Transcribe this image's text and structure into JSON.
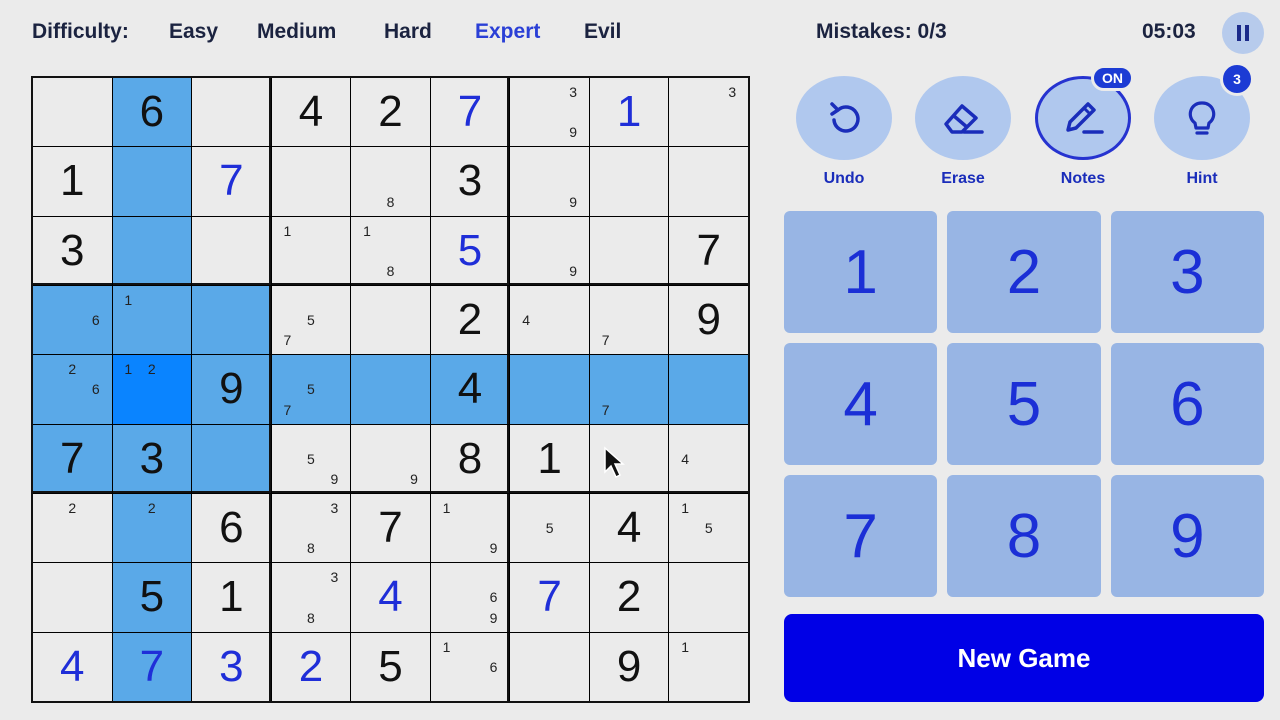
{
  "header": {
    "difficulty_label": "Difficulty:",
    "difficulties": [
      "Easy",
      "Medium",
      "Hard",
      "Expert",
      "Evil"
    ],
    "active_difficulty": "Expert",
    "mistakes": "Mistakes: 0/3",
    "timer": "05:03"
  },
  "tools": {
    "undo": "Undo",
    "erase": "Erase",
    "notes": "Notes",
    "notes_badge": "ON",
    "hint": "Hint",
    "hint_badge": "3"
  },
  "pad_numbers": [
    "1",
    "2",
    "3",
    "4",
    "5",
    "6",
    "7",
    "8",
    "9"
  ],
  "new_game": "New Game",
  "colors": {
    "accent": "#1f2ed8",
    "highlight": "#5aa9e8",
    "selected": "#0a84ff",
    "pad_key": "#98b5e4",
    "new_game": "#0000e6"
  },
  "board": {
    "selected": [
      4,
      1
    ],
    "cells": [
      [
        {
          "v": "",
          "n": []
        },
        {
          "v": "6",
          "u": false
        },
        {
          "v": "",
          "n": []
        },
        {
          "v": "4",
          "u": false
        },
        {
          "v": "2",
          "u": false
        },
        {
          "v": "7",
          "u": true
        },
        {
          "v": "",
          "n": [
            3,
            9
          ]
        },
        {
          "v": "1",
          "u": true
        },
        {
          "v": "",
          "n": [
            3
          ]
        }
      ],
      [
        {
          "v": "1",
          "u": false
        },
        {
          "v": "",
          "n": []
        },
        {
          "v": "7",
          "u": true
        },
        {
          "v": "",
          "n": []
        },
        {
          "v": "",
          "n": [
            8
          ]
        },
        {
          "v": "3",
          "u": false
        },
        {
          "v": "",
          "n": [
            9
          ]
        },
        {
          "v": "",
          "n": []
        },
        {
          "v": "",
          "n": []
        }
      ],
      [
        {
          "v": "3",
          "u": false
        },
        {
          "v": "",
          "n": []
        },
        {
          "v": "",
          "n": []
        },
        {
          "v": "",
          "n": [
            1
          ]
        },
        {
          "v": "",
          "n": [
            1,
            8
          ]
        },
        {
          "v": "5",
          "u": true
        },
        {
          "v": "",
          "n": [
            9
          ]
        },
        {
          "v": "",
          "n": []
        },
        {
          "v": "7",
          "u": false
        }
      ],
      [
        {
          "v": "",
          "n": [
            6
          ]
        },
        {
          "v": "",
          "n": [
            1
          ]
        },
        {
          "v": "",
          "n": []
        },
        {
          "v": "",
          "n": [
            5,
            7
          ]
        },
        {
          "v": "",
          "n": []
        },
        {
          "v": "2",
          "u": false
        },
        {
          "v": "",
          "n": [
            4
          ]
        },
        {
          "v": "",
          "n": [
            7
          ]
        },
        {
          "v": "9",
          "u": false
        }
      ],
      [
        {
          "v": "",
          "n": [
            2,
            6
          ]
        },
        {
          "v": "",
          "n": [
            1,
            2
          ]
        },
        {
          "v": "9",
          "u": false
        },
        {
          "v": "",
          "n": [
            5,
            7
          ]
        },
        {
          "v": "",
          "n": []
        },
        {
          "v": "4",
          "u": false
        },
        {
          "v": "",
          "n": []
        },
        {
          "v": "",
          "n": [
            7
          ]
        },
        {
          "v": "",
          "n": []
        }
      ],
      [
        {
          "v": "7",
          "u": false
        },
        {
          "v": "3",
          "u": false
        },
        {
          "v": "",
          "n": []
        },
        {
          "v": "",
          "n": [
            5,
            9
          ]
        },
        {
          "v": "",
          "n": [
            9
          ]
        },
        {
          "v": "8",
          "u": false
        },
        {
          "v": "1",
          "u": false
        },
        {
          "v": "",
          "n": []
        },
        {
          "v": "",
          "n": [
            4
          ]
        }
      ],
      [
        {
          "v": "",
          "n": [
            2
          ]
        },
        {
          "v": "",
          "n": [
            2
          ]
        },
        {
          "v": "6",
          "u": false
        },
        {
          "v": "",
          "n": [
            3,
            8
          ]
        },
        {
          "v": "7",
          "u": false
        },
        {
          "v": "",
          "n": [
            1,
            9
          ]
        },
        {
          "v": "",
          "n": [
            5
          ]
        },
        {
          "v": "4",
          "u": false
        },
        {
          "v": "",
          "n": [
            1,
            5
          ]
        }
      ],
      [
        {
          "v": "",
          "n": []
        },
        {
          "v": "5",
          "u": false
        },
        {
          "v": "1",
          "u": false
        },
        {
          "v": "",
          "n": [
            3,
            8
          ]
        },
        {
          "v": "4",
          "u": true
        },
        {
          "v": "",
          "n": [
            6,
            9
          ]
        },
        {
          "v": "7",
          "u": true
        },
        {
          "v": "2",
          "u": false
        },
        {
          "v": "",
          "n": []
        }
      ],
      [
        {
          "v": "4",
          "u": true
        },
        {
          "v": "7",
          "u": true
        },
        {
          "v": "3",
          "u": true
        },
        {
          "v": "2",
          "u": true
        },
        {
          "v": "5",
          "u": false
        },
        {
          "v": "",
          "n": [
            1,
            6
          ]
        },
        {
          "v": "",
          "n": []
        },
        {
          "v": "9",
          "u": false
        },
        {
          "v": "",
          "n": [
            1
          ]
        }
      ]
    ]
  }
}
